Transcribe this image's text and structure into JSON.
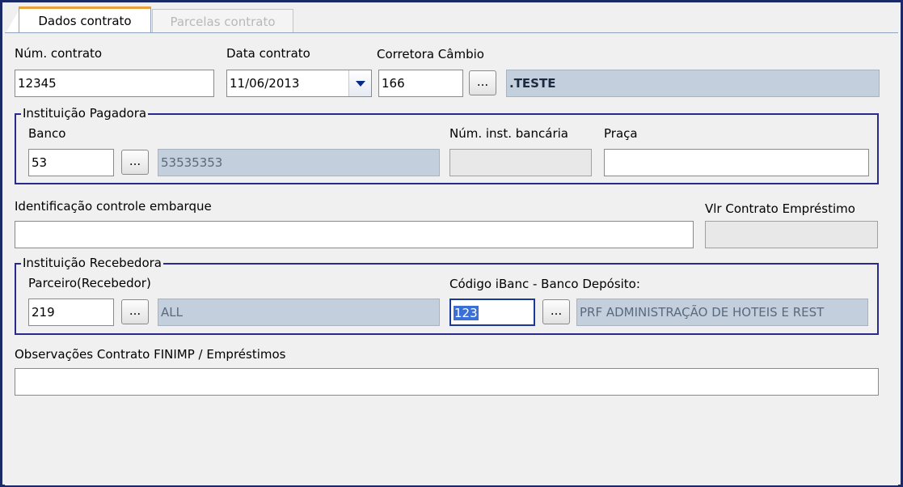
{
  "tabs": [
    {
      "label": "Dados contrato",
      "active": true
    },
    {
      "label": "Parcelas contrato",
      "active": false
    }
  ],
  "contrato": {
    "num_label": "Núm. contrato",
    "num_value": "12345",
    "data_label": "Data contrato",
    "data_value": "11/06/2013",
    "corretora_label": "Corretora Câmbio",
    "corretora_code": "166",
    "corretora_name": ".TESTE"
  },
  "pagadora": {
    "title": "Instituição Pagadora",
    "banco_label": "Banco",
    "banco_code": "53",
    "banco_name": "53535353",
    "num_inst_label": "Núm. inst. bancária",
    "num_inst_value": "",
    "praca_label": "Praça",
    "praca_value": ""
  },
  "embarque": {
    "label": "Identificação controle embarque",
    "value": "",
    "vlr_label": "Vlr Contrato Empréstimo",
    "vlr_value": ""
  },
  "recebedora": {
    "title": "Instituição Recebedora",
    "parceiro_label": "Parceiro(Recebedor)",
    "parceiro_code": "219",
    "parceiro_name": "ALL",
    "ibanc_label": "Código iBanc - Banco Depósito:",
    "ibanc_code": "123",
    "ibanc_name": "PRF ADMINISTRAÇÃO DE HOTEIS E REST"
  },
  "observacoes": {
    "label": "Observações Contrato FINIMP / Empréstimos",
    "value": ""
  },
  "ellipsis": "...",
  "icons": {
    "dropdown": "chevron-down-icon"
  }
}
